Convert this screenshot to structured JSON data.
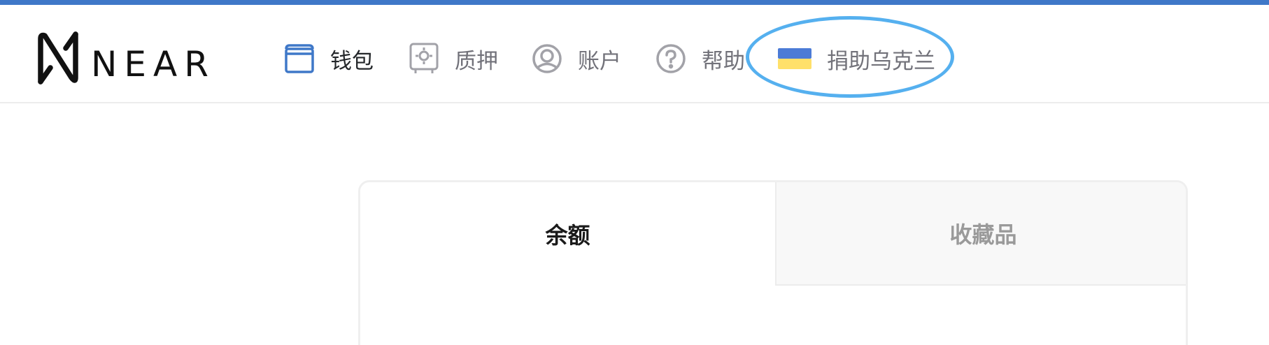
{
  "brand": {
    "name": "NEAR"
  },
  "nav": {
    "items": [
      {
        "label": "钱包",
        "icon": "wallet-icon",
        "active": true
      },
      {
        "label": "质押",
        "icon": "staking-icon",
        "active": false
      },
      {
        "label": "账户",
        "icon": "account-icon",
        "active": false
      },
      {
        "label": "帮助",
        "icon": "help-icon",
        "active": false
      },
      {
        "label": "捐助乌克兰",
        "icon": "ukraine-flag-icon",
        "active": false
      }
    ]
  },
  "tabs": [
    {
      "label": "余额",
      "active": true
    },
    {
      "label": "收藏品",
      "active": false
    }
  ],
  "colors": {
    "top_bar": "#3f78c8",
    "active_icon": "#3f78c8",
    "inactive_icon": "#a2a2a8",
    "highlight": "#55b0ef",
    "flag_blue": "#4c7bd6",
    "flag_yellow": "#ffe06a"
  }
}
